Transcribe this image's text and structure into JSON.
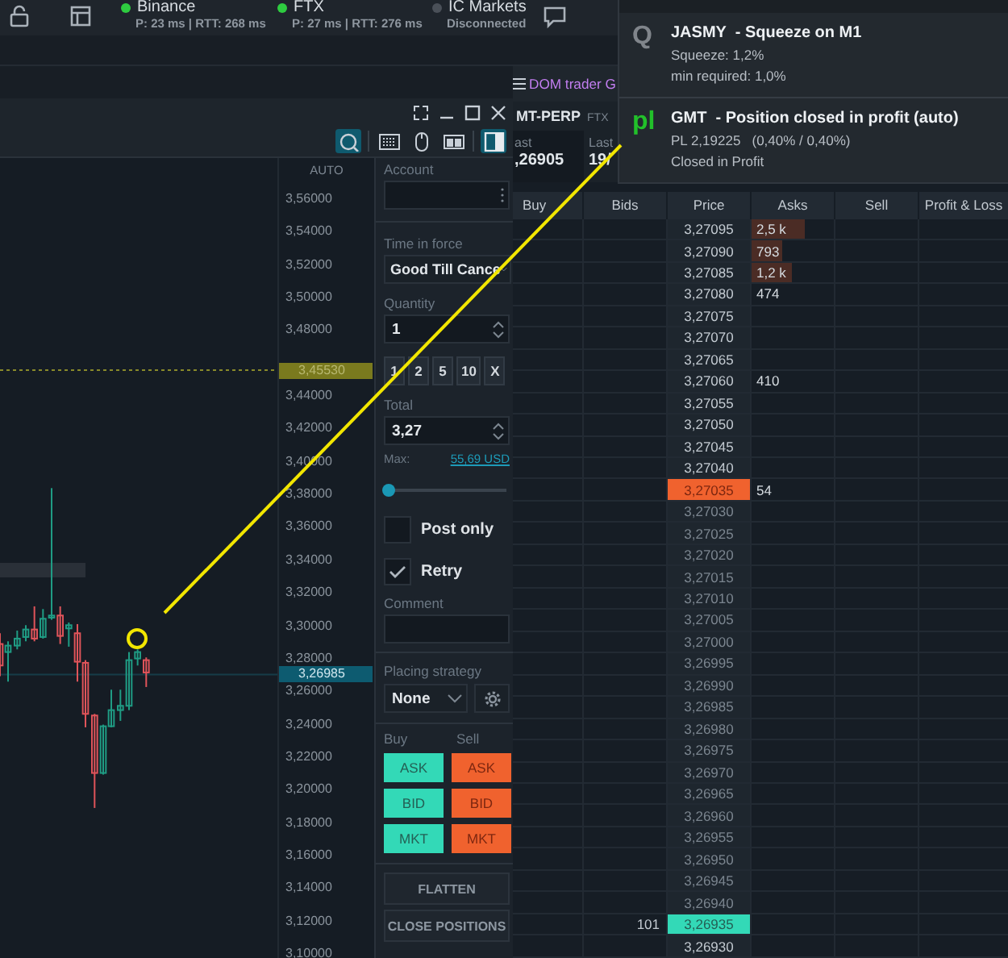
{
  "top_bar": {
    "connections": [
      {
        "name": "Binance",
        "status": "P: 23 ms | RTT: 268 ms",
        "connected": true
      },
      {
        "name": "FTX",
        "status": "P: 27 ms | RTT: 276 ms",
        "connected": true
      },
      {
        "name": "IC Markets",
        "status": "Disconnected",
        "connected": false
      }
    ]
  },
  "chart": {
    "tools": [
      {
        "kind": "magnifier",
        "on": true
      },
      {
        "kind": "keyboard",
        "on": false
      },
      {
        "kind": "mouse",
        "on": false
      },
      {
        "kind": "layout",
        "on": false
      },
      {
        "kind": "panel",
        "on": true
      }
    ],
    "price_axis": {
      "mode": "AUTO",
      "labels": [
        "3,56000",
        "3,54000",
        "3,52000",
        "3,50000",
        "3,48000",
        "3,44000",
        "3,42000",
        "3,40000",
        "3,38000",
        "3,36000",
        "3,34000",
        "3,32000",
        "3,30000",
        "3,28000",
        "3,26000",
        "3,24000",
        "3,22000",
        "3,20000",
        "3,18000",
        "3,16000",
        "3,14000",
        "3,12000",
        "3,10000"
      ],
      "markers": [
        {
          "value": "3,45530",
          "kind": "alert"
        },
        {
          "value": "3,26985",
          "kind": "last"
        }
      ]
    }
  },
  "order_panel": {
    "account": {
      "label": "Account"
    },
    "time_in_force": {
      "label": "Time in force",
      "value": "Good Till Cance"
    },
    "quantity": {
      "label": "Quantity",
      "value": "1"
    },
    "quick_amounts": [
      "1",
      "2",
      "5",
      "10",
      "X"
    ],
    "total": {
      "label": "Total",
      "value": "3,27"
    },
    "max": {
      "label": "Max:",
      "value": "55,69 USD"
    },
    "slider": {
      "level": 0
    },
    "options": [
      {
        "label": "Post only",
        "checked": false
      },
      {
        "label": "Retry",
        "checked": true
      }
    ],
    "comment": {
      "label": "Comment"
    },
    "placing_strategy": {
      "label": "Placing strategy",
      "value": "None"
    },
    "buy": {
      "label": "Buy",
      "buttons": [
        "ASK",
        "BID",
        "MKT"
      ]
    },
    "sell": {
      "label": "Sell",
      "buttons": [
        "ASK",
        "BID",
        "MKT"
      ]
    },
    "actions": [
      "FLATTEN",
      "CLOSE POSITIONS"
    ]
  },
  "dom": {
    "tab": {
      "title": "DOM trader G"
    },
    "symbol": "MT-PERP",
    "exchange": "FTX",
    "stats": [
      {
        "label": "ast",
        "value": ",26905"
      },
      {
        "label": "Last",
        "value": "19/"
      }
    ],
    "columns": [
      "Buy",
      "Bids",
      "Price",
      "Asks",
      "Sell",
      "Profit & Loss"
    ],
    "rows": [
      {
        "price": "3,27095",
        "kind": "ask",
        "asks": "2,5 k",
        "level": 0.64
      },
      {
        "price": "3,27090",
        "kind": "ask",
        "asks": "793",
        "level": 0.38
      },
      {
        "price": "3,27085",
        "kind": "ask",
        "asks": "1,2 k",
        "level": 0.49
      },
      {
        "price": "3,27080",
        "kind": "ask",
        "asks": "474"
      },
      {
        "price": "3,27075",
        "kind": "ask"
      },
      {
        "price": "3,27070",
        "kind": "ask"
      },
      {
        "price": "3,27065",
        "kind": "ask"
      },
      {
        "price": "3,27060",
        "kind": "ask",
        "asks": "410"
      },
      {
        "price": "3,27055",
        "kind": "ask"
      },
      {
        "price": "3,27050",
        "kind": "ask"
      },
      {
        "price": "3,27045",
        "kind": "ask"
      },
      {
        "price": "3,27040",
        "kind": "ask"
      },
      {
        "price": "3,27035",
        "kind": "best_ask",
        "asks": "54"
      },
      {
        "price": "3,27030",
        "kind": "mid"
      },
      {
        "price": "3,27025",
        "kind": "mid"
      },
      {
        "price": "3,27020",
        "kind": "mid"
      },
      {
        "price": "3,27015",
        "kind": "mid"
      },
      {
        "price": "3,27010",
        "kind": "mid"
      },
      {
        "price": "3,27005",
        "kind": "mid"
      },
      {
        "price": "3,27000",
        "kind": "mid"
      },
      {
        "price": "3,26995",
        "kind": "mid"
      },
      {
        "price": "3,26990",
        "kind": "mid"
      },
      {
        "price": "3,26985",
        "kind": "mid"
      },
      {
        "price": "3,26980",
        "kind": "mid"
      },
      {
        "price": "3,26975",
        "kind": "mid"
      },
      {
        "price": "3,26970",
        "kind": "mid"
      },
      {
        "price": "3,26965",
        "kind": "mid"
      },
      {
        "price": "3,26960",
        "kind": "mid"
      },
      {
        "price": "3,26955",
        "kind": "mid"
      },
      {
        "price": "3,26950",
        "kind": "mid"
      },
      {
        "price": "3,26945",
        "kind": "mid"
      },
      {
        "price": "3,26940",
        "kind": "mid"
      },
      {
        "price": "3,26935",
        "kind": "best_bid",
        "bids": "101"
      },
      {
        "price": "3,26930",
        "kind": "bid"
      }
    ]
  },
  "notifications": {
    "items": [
      {
        "badge": "Q",
        "color": "#80858b",
        "title": "JASMY  - Squeeze on M1",
        "lines": [
          "Squeeze: 1,2%",
          "min required: 1,0%"
        ]
      },
      {
        "badge": "pl",
        "color": "#22c02a",
        "title": "GMT  - Position closed in profit (auto)",
        "lines": [
          "PL 2,19225   (0,40% / 0,40%)",
          "Closed in Profit"
        ]
      }
    ]
  }
}
